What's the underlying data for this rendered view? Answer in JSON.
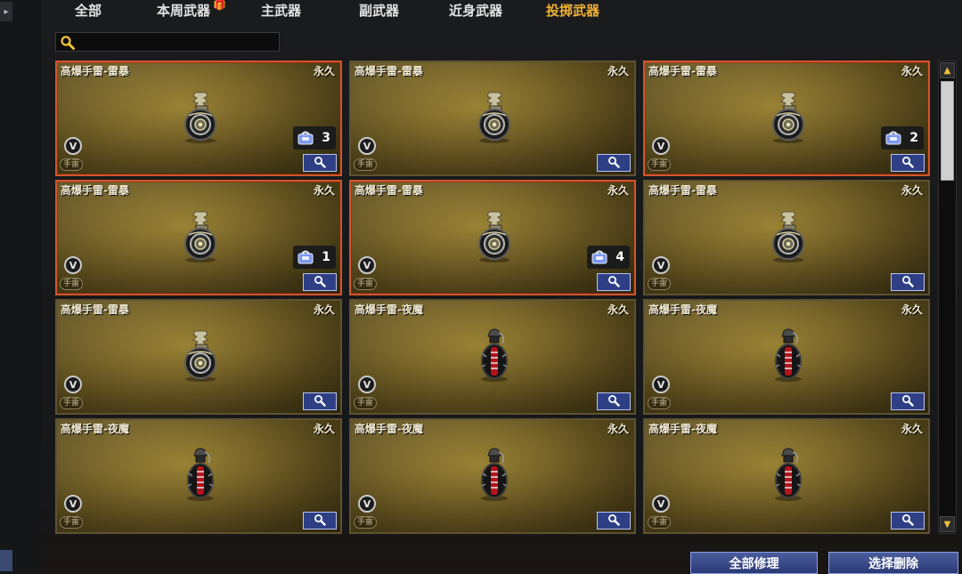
{
  "tabs": [
    {
      "label": "全部",
      "active": false
    },
    {
      "label": "本周武器",
      "active": false,
      "gift_icon": "gift-icon"
    },
    {
      "label": "主武器",
      "active": false
    },
    {
      "label": "副武器",
      "active": false
    },
    {
      "label": "近身武器",
      "active": false
    },
    {
      "label": "投掷武器",
      "active": true
    }
  ],
  "search": {
    "icon": "search-icon",
    "value": ""
  },
  "items": [
    {
      "name": "高爆手雷-雷暴",
      "duration": "永久",
      "tag": "手雷",
      "vip": "V",
      "count": "3",
      "selected": true,
      "variant": "thunder"
    },
    {
      "name": "高爆手雷-雷暴",
      "duration": "永久",
      "tag": "手雷",
      "vip": "V",
      "count": "",
      "selected": false,
      "variant": "thunder"
    },
    {
      "name": "高爆手雷-雷暴",
      "duration": "永久",
      "tag": "手雷",
      "vip": "V",
      "count": "2",
      "selected": true,
      "variant": "thunder"
    },
    {
      "name": "高爆手雷-雷暴",
      "duration": "永久",
      "tag": "手雷",
      "vip": "V",
      "count": "1",
      "selected": true,
      "variant": "thunder"
    },
    {
      "name": "高爆手雷-雷暴",
      "duration": "永久",
      "tag": "手雷",
      "vip": "V",
      "count": "4",
      "selected": true,
      "variant": "thunder"
    },
    {
      "name": "高爆手雷-雷暴",
      "duration": "永久",
      "tag": "手雷",
      "vip": "V",
      "count": "",
      "selected": false,
      "variant": "thunder"
    },
    {
      "name": "高爆手雷-雷暴",
      "duration": "永久",
      "tag": "手雷",
      "vip": "V",
      "count": "",
      "selected": false,
      "variant": "thunder"
    },
    {
      "name": "高爆手雷-夜魔",
      "duration": "永久",
      "tag": "手雷",
      "vip": "V",
      "count": "",
      "selected": false,
      "variant": "night"
    },
    {
      "name": "高爆手雷-夜魔",
      "duration": "永久",
      "tag": "手雷",
      "vip": "V",
      "count": "",
      "selected": false,
      "variant": "night"
    },
    {
      "name": "高爆手雷-夜魔",
      "duration": "永久",
      "tag": "手雷",
      "vip": "V",
      "count": "",
      "selected": false,
      "variant": "night"
    },
    {
      "name": "高爆手雷-夜魔",
      "duration": "永久",
      "tag": "手雷",
      "vip": "V",
      "count": "",
      "selected": false,
      "variant": "night"
    },
    {
      "name": "高爆手雷-夜魔",
      "duration": "永久",
      "tag": "手雷",
      "vip": "V",
      "count": "",
      "selected": false,
      "variant": "night"
    }
  ],
  "buttons": {
    "repair_all": "全部修理",
    "delete_selected": "选择删除"
  },
  "colors": {
    "active_tab": "#f0b236",
    "selected_border": "#d0562a",
    "button": "#2e3f86"
  }
}
